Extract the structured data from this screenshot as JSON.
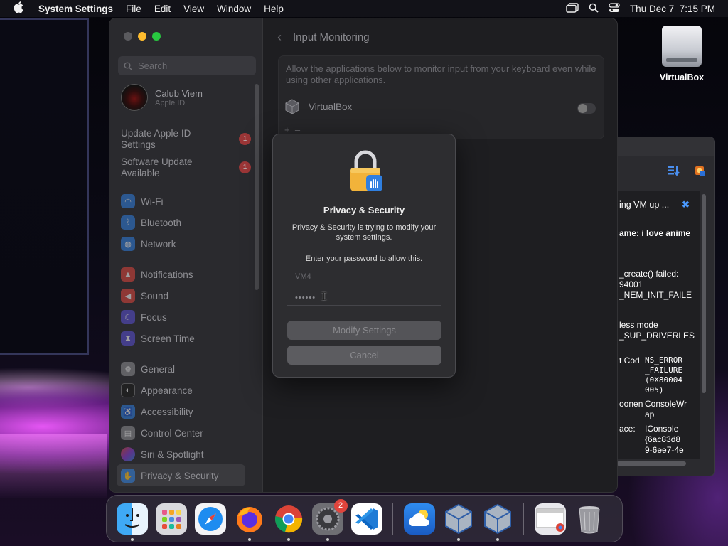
{
  "menubar": {
    "app": "System Settings",
    "menus": [
      "File",
      "Edit",
      "View",
      "Window",
      "Help"
    ],
    "clock": "Thu Dec 7  7:15 PM"
  },
  "desktop": {
    "icon_label": "VirtualBox"
  },
  "vbox_log": {
    "lines": [
      {
        "a": "ing VM up ...",
        "b": ""
      },
      {
        "a": "ame: i love anime",
        "b": ""
      },
      {
        "a": "_create() failed:",
        "b": ""
      },
      {
        "a": "94001",
        "b": ""
      },
      {
        "a": "_NEM_INIT_FAILE",
        "b": ""
      },
      {
        "a": "less mode",
        "b": ""
      },
      {
        "a": "_SUP_DRIVERLES",
        "b": ""
      },
      {
        "a": "t Cod",
        "b": "NS_ERROR"
      },
      {
        "a": "",
        "b": "_FAILURE"
      },
      {
        "a": "",
        "b": "(0X80004"
      },
      {
        "a": "",
        "b": "005)"
      },
      {
        "a": "oonen",
        "b": "ConsoleWr"
      },
      {
        "a": "",
        "b": "ap"
      },
      {
        "a": "ace:",
        "b": "IConsole"
      },
      {
        "a": "",
        "b": "{6ac83d8"
      },
      {
        "a": "",
        "b": "9-6ee7-4e"
      }
    ]
  },
  "settings": {
    "search_placeholder": "Search",
    "account": {
      "name": "Calub Viem",
      "sub": "Apple ID"
    },
    "updates": [
      {
        "label": "Update Apple ID Settings",
        "badge": "1"
      },
      {
        "label": "Software Update Available",
        "badge": "1"
      }
    ],
    "sidebar": [
      {
        "label": "Wi-Fi",
        "icon": "wifi-icon",
        "color": "#2f7fe0"
      },
      {
        "label": "Bluetooth",
        "icon": "bluetooth-icon",
        "color": "#2f7fe0"
      },
      {
        "label": "Network",
        "icon": "globe-icon",
        "color": "#2f7fe0"
      },
      {
        "label": "Notifications",
        "icon": "bell-icon",
        "color": "#e0443c"
      },
      {
        "label": "Sound",
        "icon": "speaker-icon",
        "color": "#e0443c"
      },
      {
        "label": "Focus",
        "icon": "moon-icon",
        "color": "#5a4fd6"
      },
      {
        "label": "Screen Time",
        "icon": "hourglass-icon",
        "color": "#5a4fd6"
      },
      {
        "label": "General",
        "icon": "gear-icon",
        "color": "#8e8e93"
      },
      {
        "label": "Appearance",
        "icon": "appearance-icon",
        "color": "#222"
      },
      {
        "label": "Accessibility",
        "icon": "accessibility-icon",
        "color": "#2f7fe0"
      },
      {
        "label": "Control Center",
        "icon": "control-center-icon",
        "color": "#8e8e93"
      },
      {
        "label": "Siri & Spotlight",
        "icon": "siri-icon",
        "color": "#c040c0"
      },
      {
        "label": "Privacy & Security",
        "icon": "hand-icon",
        "color": "#2f7fe0"
      }
    ],
    "page_title": "Input Monitoring",
    "description": "Allow the applications below to monitor input from your keyboard even while using other applications.",
    "apps": [
      {
        "name": "VirtualBox",
        "enabled": false
      }
    ],
    "list_controls": "+  –"
  },
  "dialog": {
    "title": "Privacy & Security",
    "message": "Privacy & Security is trying to modify your system settings.",
    "prompt": "Enter your password to allow this.",
    "username": "VM4",
    "password_mask": "••••••",
    "primary_button": "Modify Settings",
    "cancel_button": "Cancel"
  },
  "dock": {
    "system_settings_badge": "2"
  },
  "colors": {
    "accent": "#2f7fe0",
    "close": "#ff5f57",
    "minimize": "#febc2e",
    "zoom": "#28c840"
  }
}
